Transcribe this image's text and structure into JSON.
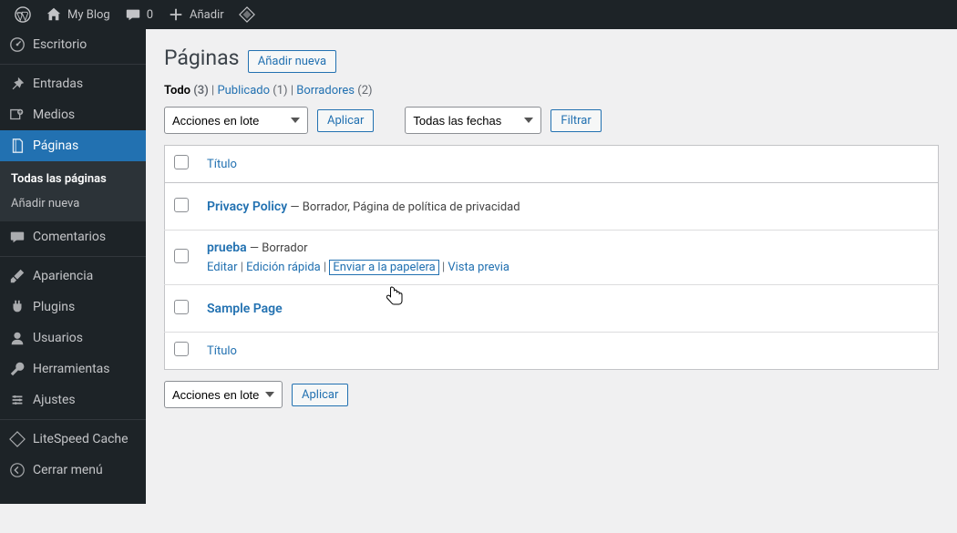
{
  "adminbar": {
    "site_title": "My Blog",
    "comment_count": "0",
    "add_new": "Añadir",
    "wp_icon": "wordpress-logo",
    "home_icon": "home-icon",
    "comment_icon": "comment-icon",
    "plus_icon": "plus-icon",
    "cache_icon": "litespeed-icon"
  },
  "sidebar": {
    "items": [
      {
        "label": "Escritorio",
        "icon": "dashboard-icon"
      },
      {
        "label": "Entradas",
        "icon": "pin-icon"
      },
      {
        "label": "Medios",
        "icon": "media-icon"
      },
      {
        "label": "Páginas",
        "icon": "page-icon",
        "current": true
      },
      {
        "label": "Comentarios",
        "icon": "comment-icon"
      },
      {
        "label": "Apariencia",
        "icon": "brush-icon"
      },
      {
        "label": "Plugins",
        "icon": "plugin-icon"
      },
      {
        "label": "Usuarios",
        "icon": "user-icon"
      },
      {
        "label": "Herramientas",
        "icon": "tools-icon"
      },
      {
        "label": "Ajustes",
        "icon": "settings-icon"
      },
      {
        "label": "LiteSpeed Cache",
        "icon": "litespeed-icon"
      },
      {
        "label": "Cerrar menú",
        "icon": "collapse-icon"
      }
    ],
    "submenu": {
      "all_pages": "Todas las páginas",
      "add_new": "Añadir nueva"
    }
  },
  "page": {
    "title": "Páginas",
    "add_new_button": "Añadir nueva",
    "filters": {
      "all_label": "Todo",
      "all_count": "(3)",
      "published_label": "Publicado",
      "published_count": "(1)",
      "drafts_label": "Borradores",
      "drafts_count": "(2)"
    },
    "bulk_actions": {
      "label": "Acciones en lote",
      "apply": "Aplicar"
    },
    "date_filter": {
      "label": "Todas las fechas",
      "filter_button": "Filtrar"
    },
    "table": {
      "col_title": "Título",
      "rows": [
        {
          "title": "Privacy Policy",
          "state": " — Borrador, Página de política de privacidad"
        },
        {
          "title": "prueba",
          "state": " — Borrador",
          "actions": {
            "edit": "Editar",
            "quick": "Edición rápida",
            "trash": "Enviar a la papelera",
            "preview": "Vista previa"
          }
        },
        {
          "title": "Sample Page",
          "state": ""
        }
      ]
    }
  }
}
